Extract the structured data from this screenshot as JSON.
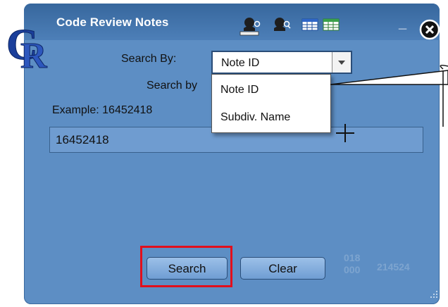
{
  "window": {
    "title": "Code Review Notes",
    "logo_text": "CR",
    "toolbar_icons": [
      "user-search-icon",
      "user-lookup-icon",
      "table-view-icon",
      "grid-view-icon"
    ],
    "minimize_label": "_"
  },
  "search": {
    "search_by_label": "Search By:",
    "selected_option": "Note ID",
    "options": [
      "Note ID",
      "Subdiv. Name"
    ],
    "search_by_truncated": "Search by",
    "example": "Example: 16452418",
    "field_value": "16452418"
  },
  "buttons": {
    "search": "Search",
    "clear": "Clear"
  },
  "background_text": {
    "fragment_1": "018",
    "fragment_2": "000",
    "fragment_3": "214524"
  },
  "colors": {
    "panel": "#5d8ec4",
    "titlebar": "#37679d",
    "highlight_border": "#e20f1c"
  }
}
